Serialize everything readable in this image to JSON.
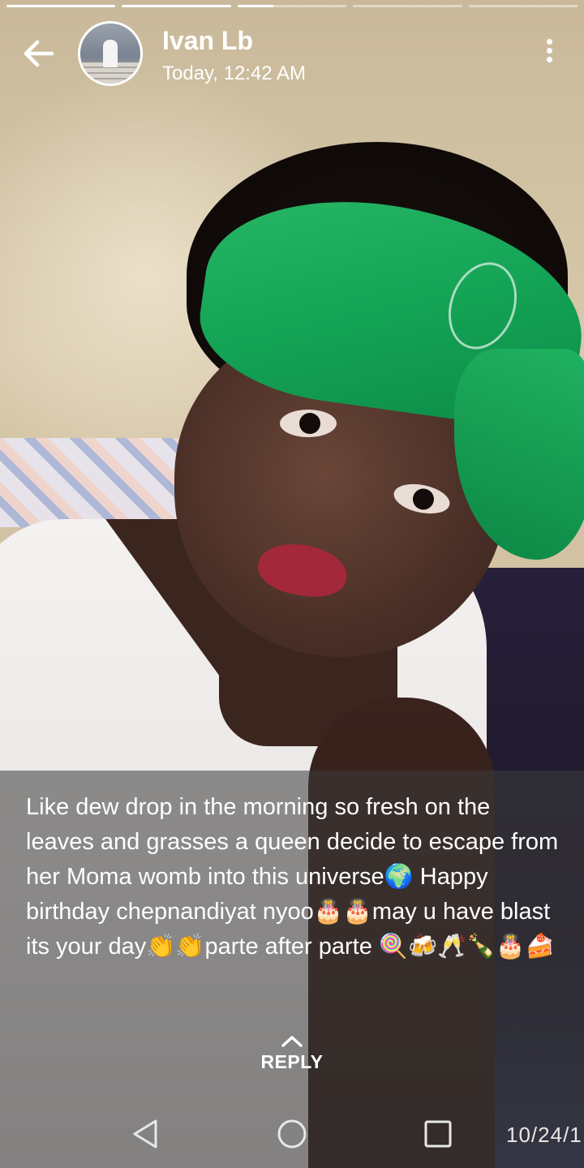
{
  "story": {
    "progress_segments": [
      1,
      1,
      0.33,
      0,
      0
    ]
  },
  "header": {
    "sender_name": "Ivan Lb",
    "timestamp": "Today, 12:42 AM",
    "back_icon": "arrow-left-icon",
    "menu_icon": "more-vertical-icon"
  },
  "caption": {
    "text": "Like dew drop in the morning so fresh on the leaves and grasses a queen decide to escape from her Moma womb into this universe🌍 Happy birthday chepnandiyat nyoo🎂🎂may u have blast its your day👏👏parte after parte 🍭🍻🥂🍾🎂🍰"
  },
  "reply": {
    "label": "REPLY",
    "icon": "chevron-up-icon"
  },
  "photo": {
    "date_stamp": "10/24/1"
  },
  "navbar": {
    "back_icon": "nav-back-triangle-icon",
    "home_icon": "nav-home-circle-icon",
    "recents_icon": "nav-recents-square-icon"
  }
}
